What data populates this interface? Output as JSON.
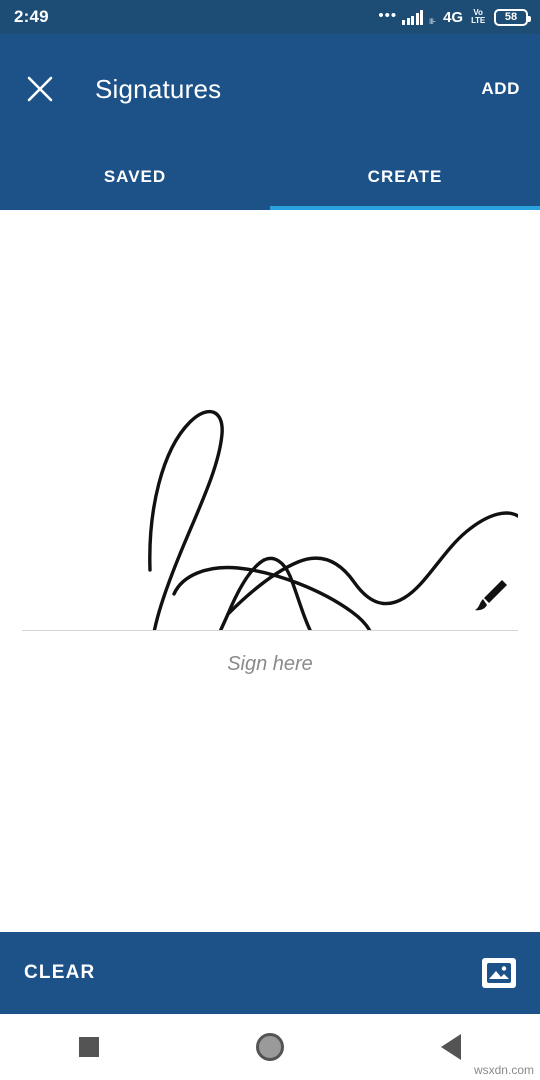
{
  "status_bar": {
    "time": "2:49",
    "dots_icon": "more-dots-icon",
    "signal_icon": "signal-bars-icon",
    "network_label": "4G",
    "volte_line1": "Vo",
    "volte_line2": "LTE",
    "battery_percent": "58"
  },
  "appbar": {
    "close_icon": "close-icon",
    "title": "Signatures",
    "add_label": "ADD"
  },
  "tabs": {
    "items": [
      {
        "label": "SAVED",
        "active": false
      },
      {
        "label": "CREATE",
        "active": true
      }
    ],
    "indicator_color": "#29a3e0"
  },
  "canvas": {
    "hint": "Sign here",
    "brush_icon": "brush-icon",
    "ink_color": "#111111"
  },
  "bottom_bar": {
    "clear_label": "CLEAR",
    "image_icon": "image-picker-icon"
  },
  "nav_bar": {
    "recents_icon": "square-recents-icon",
    "home_icon": "circle-home-icon",
    "back_icon": "triangle-back-icon"
  },
  "watermark": "wsxdn.com",
  "colors": {
    "status_bar": "#1d4c75",
    "app_bar": "#1d5289",
    "accent": "#29a3e0"
  }
}
